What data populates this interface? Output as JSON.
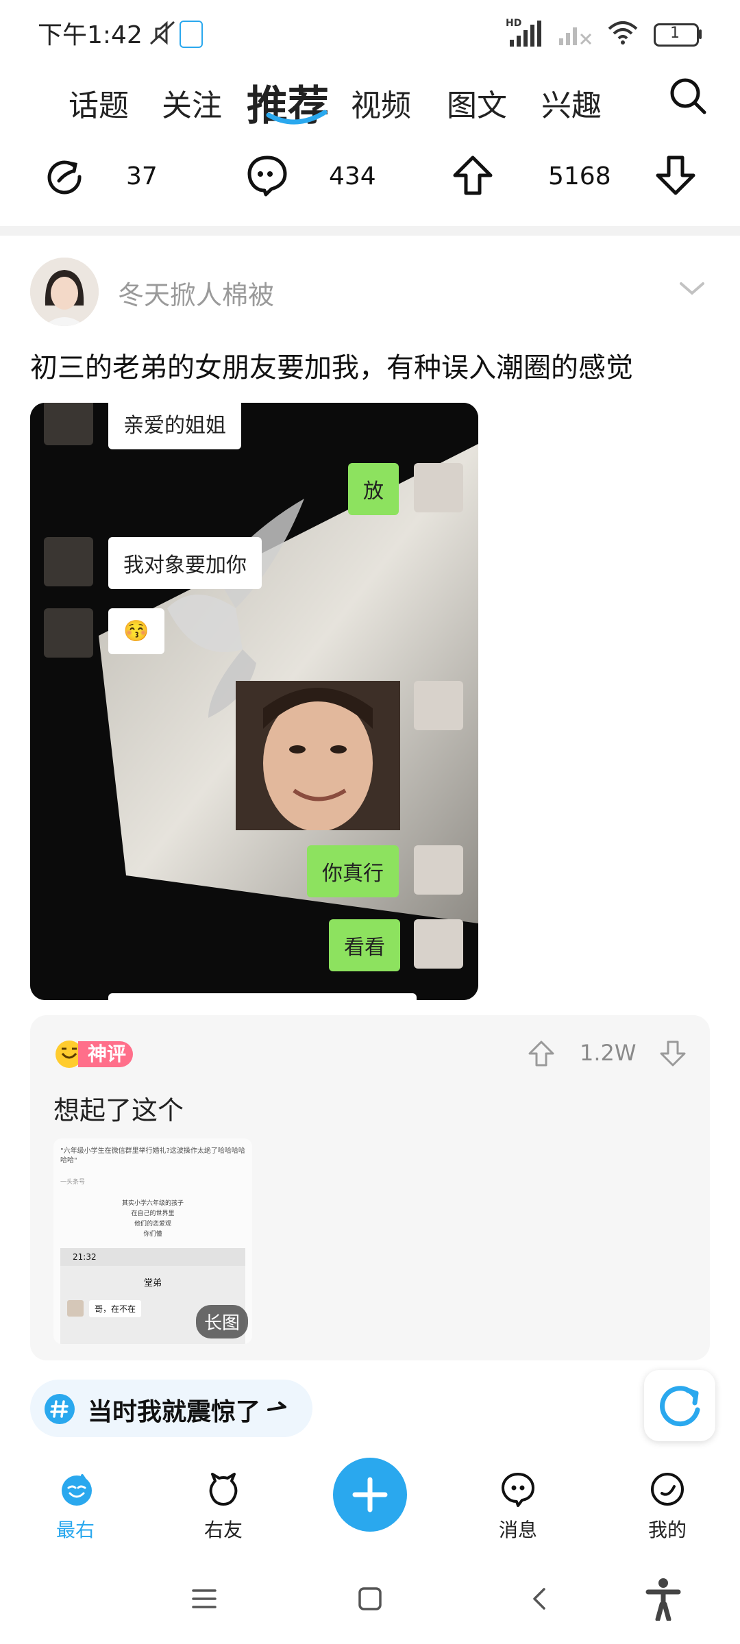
{
  "status": {
    "time": "下午1:42",
    "hd": "HD",
    "battery": "1"
  },
  "tabs": [
    {
      "label": "话题",
      "active": false
    },
    {
      "label": "关注",
      "active": false
    },
    {
      "label": "推荐",
      "active": true
    },
    {
      "label": "视频",
      "active": false
    },
    {
      "label": "图文",
      "active": false
    },
    {
      "label": "兴趣",
      "active": false
    }
  ],
  "stats": {
    "shares": "37",
    "comments": "434",
    "upvotes": "5168"
  },
  "post": {
    "username": "冬天掀人棉被",
    "title": "初三的老弟的女朋友要加我，有种误入潮圈的感觉",
    "chat": {
      "msg1": "亲爱的姐姐",
      "msg2": "放",
      "msg3": "我对象要加你",
      "msg4": "😚",
      "msg5": "你真行",
      "msg6": "看看"
    }
  },
  "god_comment": {
    "badge": "神评",
    "likes": "1.2W",
    "text": "想起了这个",
    "thumb": {
      "headline": "\"六年级小学生在微信群里举行婚礼?这波操作太绝了哈哈哈哈哈哈\"",
      "source": "一头条号",
      "lines": [
        "其实小学六年级的孩子",
        "在自己的世界里",
        "他们的恋爱观",
        "你们懂"
      ],
      "time": "21:32",
      "chat_title": "堂弟",
      "chat_msg": "哥，在不在",
      "tag": "长图"
    }
  },
  "topic": {
    "label": "当时我就震惊了"
  },
  "nav": [
    {
      "label": "最右",
      "active": true
    },
    {
      "label": "右友",
      "active": false
    },
    {
      "label": "消息",
      "active": false
    },
    {
      "label": "我的",
      "active": false
    }
  ],
  "colors": {
    "accent": "#2aa8ee",
    "green_bubble": "#8de25f",
    "badge": "#ff6f8a"
  }
}
